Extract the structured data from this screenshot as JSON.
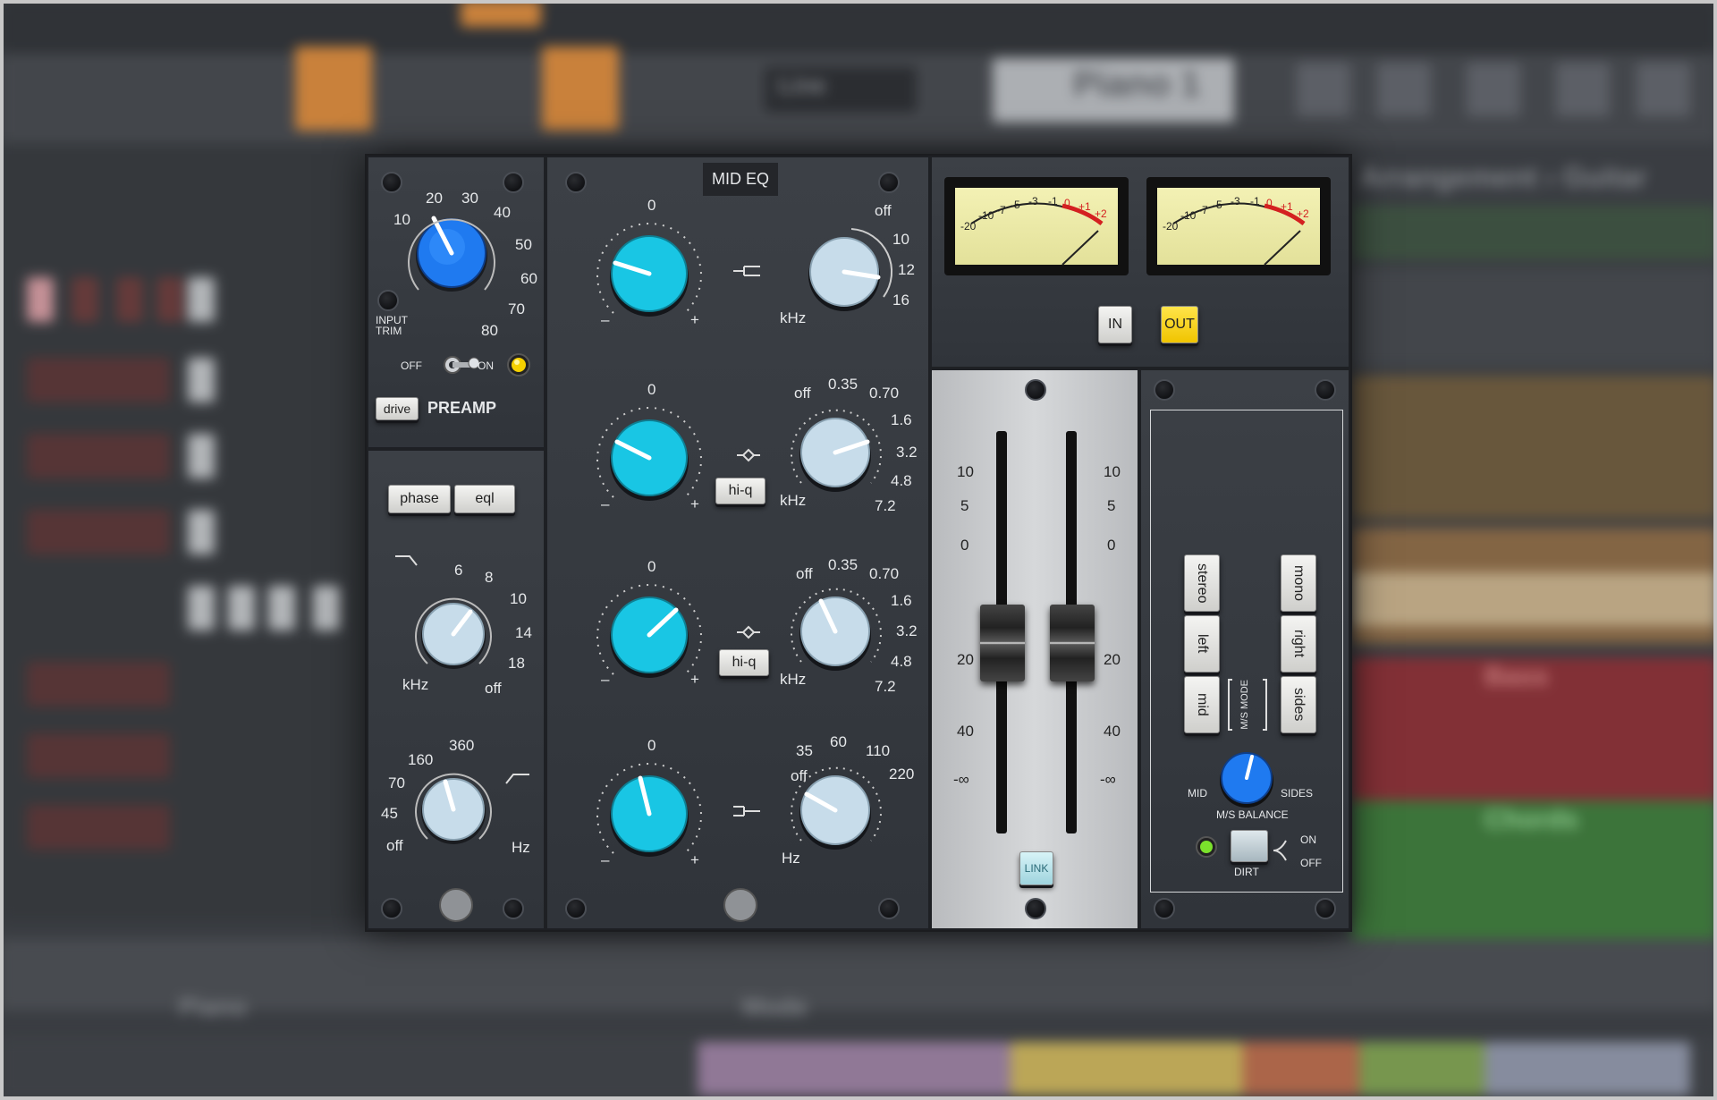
{
  "colors": {
    "accent_blue": "#1e7bf0",
    "accent_cyan": "#19c6e4",
    "indicator_yellow": "#f5d000",
    "led_green": "#7be22c"
  },
  "preamp": {
    "title": "PREAMP",
    "drive_label": "drive",
    "input_trim_label": "INPUT\nTRIM",
    "off_label": "OFF",
    "on_label": "ON",
    "knob_scale": [
      "10",
      "20",
      "30",
      "40",
      "50",
      "60",
      "70",
      "80"
    ],
    "drive_value": 20
  },
  "filters": {
    "phase_label": "phase",
    "eql_label": "eql",
    "lpf_scale": [
      "6",
      "8",
      "10",
      "14",
      "18",
      "off"
    ],
    "lpf_unit": "kHz",
    "hpf_scale": [
      "off",
      "45",
      "70",
      "160",
      "360"
    ],
    "hpf_unit": "Hz"
  },
  "eq": {
    "title": "MID EQ",
    "gain_center": "0",
    "minus": "–",
    "plus": "+",
    "hiq_label": "hi-q",
    "band1_freq_scale": [
      "off",
      "10",
      "12",
      "16"
    ],
    "band1_unit": "kHz",
    "band2_freq_scale": [
      "off",
      "0.35",
      "0.70",
      "1.6",
      "3.2",
      "4.8",
      "7.2"
    ],
    "band2_unit": "kHz",
    "band3_freq_scale": [
      "off",
      "0.35",
      "0.70",
      "1.6",
      "3.2",
      "4.8",
      "7.2"
    ],
    "band3_unit": "kHz",
    "band4_freq_scale": [
      "off",
      "35",
      "60",
      "110",
      "220"
    ],
    "band4_unit": "Hz"
  },
  "meters": {
    "scale": [
      "-20",
      "-10",
      "-7",
      "-5",
      "-3",
      "-1",
      "0",
      "+1",
      "+2"
    ],
    "in_label": "IN",
    "out_label": "OUT",
    "out_active": true
  },
  "faders": {
    "scale": [
      "10",
      "5",
      "0",
      "20",
      "40",
      "-∞"
    ],
    "link_label": "LINK"
  },
  "ms": {
    "left_buttons": [
      "stereo",
      "left",
      "mid"
    ],
    "right_buttons": [
      "mono",
      "right",
      "sides"
    ],
    "mode_label": "M/S MODE",
    "mid_label": "MID",
    "sides_label": "SIDES",
    "balance_label": "M/S BALANCE",
    "dirt_label": "DIRT",
    "on_label": "ON",
    "off_label": "OFF"
  },
  "background": {
    "dropdown_text": "Line",
    "track_name": "Piano 1",
    "breadcrumb": "Arrangement › Guitar",
    "track_bass": "Bass",
    "track_chords": "Chords",
    "bottom_label": "Piano",
    "bottom_mode": "Mode"
  }
}
